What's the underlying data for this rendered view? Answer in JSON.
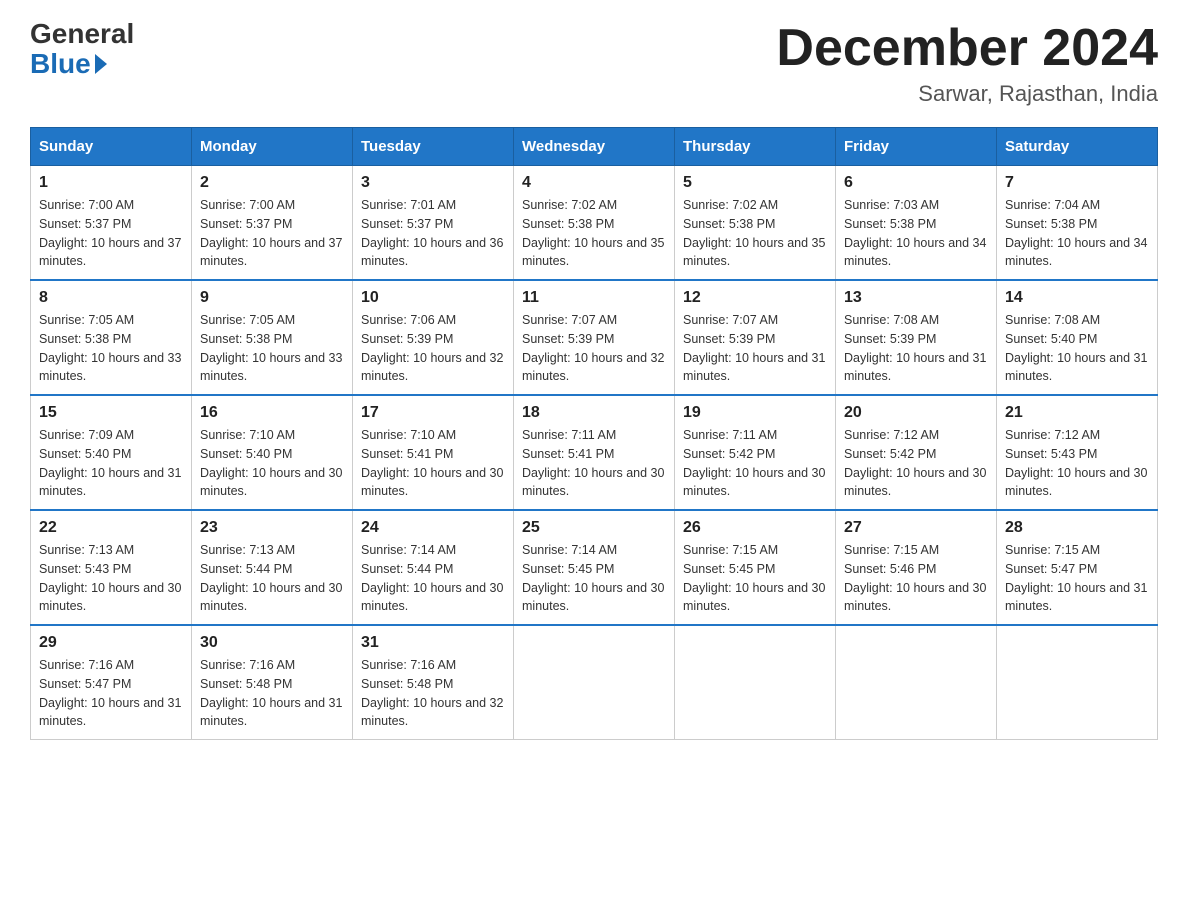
{
  "header": {
    "logo_general": "General",
    "logo_blue": "Blue",
    "month_title": "December 2024",
    "location": "Sarwar, Rajasthan, India"
  },
  "days_of_week": [
    "Sunday",
    "Monday",
    "Tuesday",
    "Wednesday",
    "Thursday",
    "Friday",
    "Saturday"
  ],
  "weeks": [
    [
      {
        "date": "1",
        "sunrise": "7:00 AM",
        "sunset": "5:37 PM",
        "daylight": "10 hours and 37 minutes."
      },
      {
        "date": "2",
        "sunrise": "7:00 AM",
        "sunset": "5:37 PM",
        "daylight": "10 hours and 37 minutes."
      },
      {
        "date": "3",
        "sunrise": "7:01 AM",
        "sunset": "5:37 PM",
        "daylight": "10 hours and 36 minutes."
      },
      {
        "date": "4",
        "sunrise": "7:02 AM",
        "sunset": "5:38 PM",
        "daylight": "10 hours and 35 minutes."
      },
      {
        "date": "5",
        "sunrise": "7:02 AM",
        "sunset": "5:38 PM",
        "daylight": "10 hours and 35 minutes."
      },
      {
        "date": "6",
        "sunrise": "7:03 AM",
        "sunset": "5:38 PM",
        "daylight": "10 hours and 34 minutes."
      },
      {
        "date": "7",
        "sunrise": "7:04 AM",
        "sunset": "5:38 PM",
        "daylight": "10 hours and 34 minutes."
      }
    ],
    [
      {
        "date": "8",
        "sunrise": "7:05 AM",
        "sunset": "5:38 PM",
        "daylight": "10 hours and 33 minutes."
      },
      {
        "date": "9",
        "sunrise": "7:05 AM",
        "sunset": "5:38 PM",
        "daylight": "10 hours and 33 minutes."
      },
      {
        "date": "10",
        "sunrise": "7:06 AM",
        "sunset": "5:39 PM",
        "daylight": "10 hours and 32 minutes."
      },
      {
        "date": "11",
        "sunrise": "7:07 AM",
        "sunset": "5:39 PM",
        "daylight": "10 hours and 32 minutes."
      },
      {
        "date": "12",
        "sunrise": "7:07 AM",
        "sunset": "5:39 PM",
        "daylight": "10 hours and 31 minutes."
      },
      {
        "date": "13",
        "sunrise": "7:08 AM",
        "sunset": "5:39 PM",
        "daylight": "10 hours and 31 minutes."
      },
      {
        "date": "14",
        "sunrise": "7:08 AM",
        "sunset": "5:40 PM",
        "daylight": "10 hours and 31 minutes."
      }
    ],
    [
      {
        "date": "15",
        "sunrise": "7:09 AM",
        "sunset": "5:40 PM",
        "daylight": "10 hours and 31 minutes."
      },
      {
        "date": "16",
        "sunrise": "7:10 AM",
        "sunset": "5:40 PM",
        "daylight": "10 hours and 30 minutes."
      },
      {
        "date": "17",
        "sunrise": "7:10 AM",
        "sunset": "5:41 PM",
        "daylight": "10 hours and 30 minutes."
      },
      {
        "date": "18",
        "sunrise": "7:11 AM",
        "sunset": "5:41 PM",
        "daylight": "10 hours and 30 minutes."
      },
      {
        "date": "19",
        "sunrise": "7:11 AM",
        "sunset": "5:42 PM",
        "daylight": "10 hours and 30 minutes."
      },
      {
        "date": "20",
        "sunrise": "7:12 AM",
        "sunset": "5:42 PM",
        "daylight": "10 hours and 30 minutes."
      },
      {
        "date": "21",
        "sunrise": "7:12 AM",
        "sunset": "5:43 PM",
        "daylight": "10 hours and 30 minutes."
      }
    ],
    [
      {
        "date": "22",
        "sunrise": "7:13 AM",
        "sunset": "5:43 PM",
        "daylight": "10 hours and 30 minutes."
      },
      {
        "date": "23",
        "sunrise": "7:13 AM",
        "sunset": "5:44 PM",
        "daylight": "10 hours and 30 minutes."
      },
      {
        "date": "24",
        "sunrise": "7:14 AM",
        "sunset": "5:44 PM",
        "daylight": "10 hours and 30 minutes."
      },
      {
        "date": "25",
        "sunrise": "7:14 AM",
        "sunset": "5:45 PM",
        "daylight": "10 hours and 30 minutes."
      },
      {
        "date": "26",
        "sunrise": "7:15 AM",
        "sunset": "5:45 PM",
        "daylight": "10 hours and 30 minutes."
      },
      {
        "date": "27",
        "sunrise": "7:15 AM",
        "sunset": "5:46 PM",
        "daylight": "10 hours and 30 minutes."
      },
      {
        "date": "28",
        "sunrise": "7:15 AM",
        "sunset": "5:47 PM",
        "daylight": "10 hours and 31 minutes."
      }
    ],
    [
      {
        "date": "29",
        "sunrise": "7:16 AM",
        "sunset": "5:47 PM",
        "daylight": "10 hours and 31 minutes."
      },
      {
        "date": "30",
        "sunrise": "7:16 AM",
        "sunset": "5:48 PM",
        "daylight": "10 hours and 31 minutes."
      },
      {
        "date": "31",
        "sunrise": "7:16 AM",
        "sunset": "5:48 PM",
        "daylight": "10 hours and 32 minutes."
      },
      null,
      null,
      null,
      null
    ]
  ]
}
